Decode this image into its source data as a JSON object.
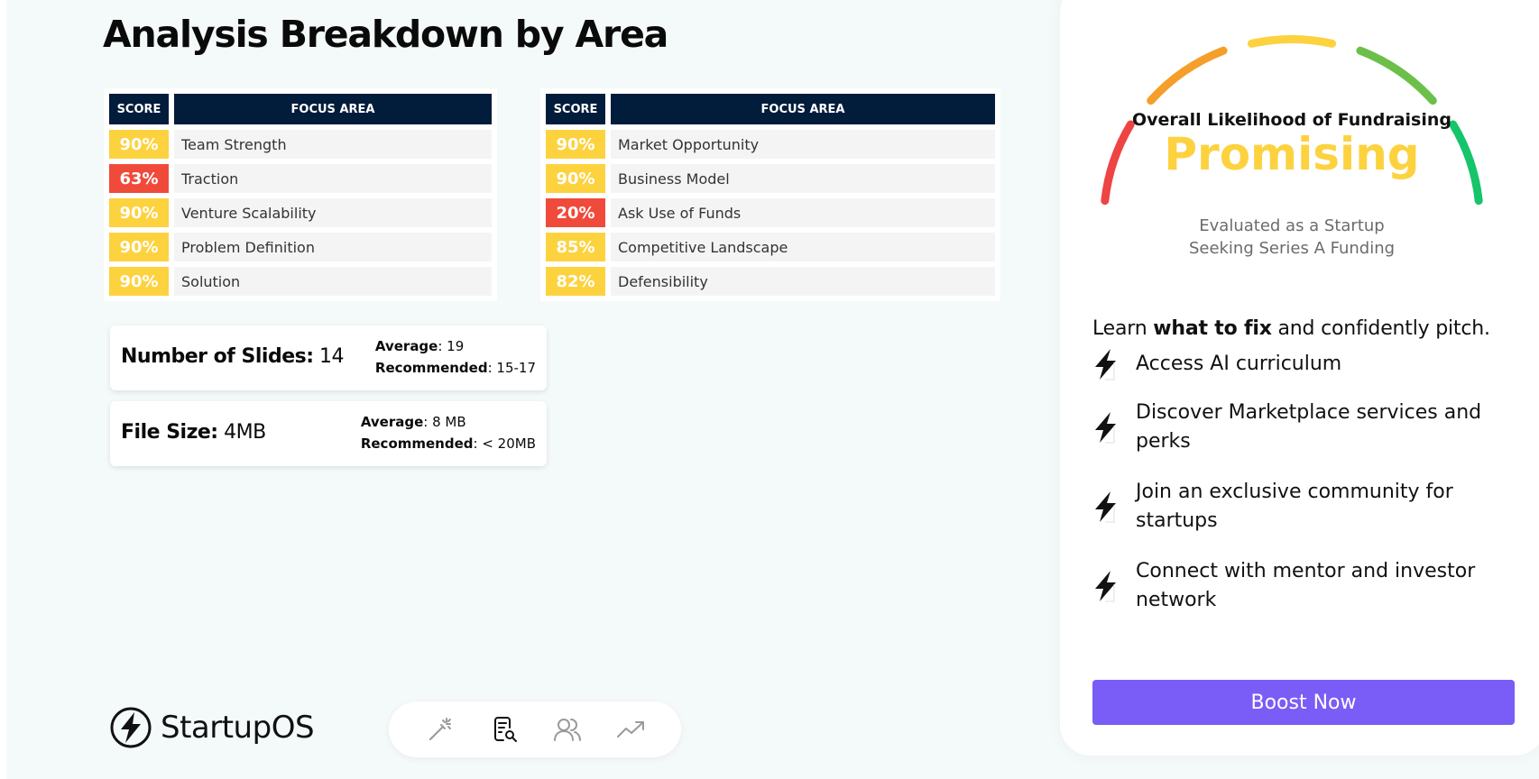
{
  "page": {
    "title": "Analysis Breakdown by Area"
  },
  "tables": {
    "score_header": "SCORE",
    "focus_header": "FOCUS AREA",
    "left": [
      {
        "score": "90%",
        "area": "Team Strength",
        "level": "high"
      },
      {
        "score": "63%",
        "area": "Traction",
        "level": "low"
      },
      {
        "score": "90%",
        "area": "Venture Scalability",
        "level": "high"
      },
      {
        "score": "90%",
        "area": "Problem Definition",
        "level": "high"
      },
      {
        "score": "90%",
        "area": "Solution",
        "level": "high"
      }
    ],
    "right": [
      {
        "score": "90%",
        "area": "Market Opportunity",
        "level": "high"
      },
      {
        "score": "90%",
        "area": "Business Model",
        "level": "high"
      },
      {
        "score": "20%",
        "area": "Ask Use of Funds",
        "level": "low"
      },
      {
        "score": "85%",
        "area": "Competitive Landscape",
        "level": "high"
      },
      {
        "score": "82%",
        "area": "Defensibility",
        "level": "high"
      }
    ]
  },
  "stats": {
    "slides": {
      "label": "Number of Slides:",
      "value": "14",
      "average_label": "Average",
      "average_value": ": 19",
      "recommended_label": "Recommended",
      "recommended_value": ": 15-17"
    },
    "filesize": {
      "label": "File Size:",
      "value": "4MB",
      "average_label": "Average",
      "average_value": ": 8 MB",
      "recommended_label": "Recommended",
      "recommended_value": ": < 20MB"
    }
  },
  "footer": {
    "brand": "StartupOS",
    "toolbar_icons": [
      "magic-wand-icon",
      "document-search-icon",
      "users-icon",
      "trending-up-icon"
    ]
  },
  "panel": {
    "gauge_title": "Overall Likelihood of Fundraising",
    "status": "Promising",
    "evaluated_line1": "Evaluated as a Startup",
    "evaluated_line2": "Seeking Series A Funding",
    "learn_prefix": "Learn ",
    "learn_bold": "what to fix",
    "learn_suffix": " and confidently pitch.",
    "benefits": [
      "Access AI curriculum",
      "Discover Marketplace services and perks",
      "Join an exclusive community for startups",
      "Connect with mentor and investor network"
    ],
    "boost_label": "Boost Now"
  },
  "colors": {
    "score_high": "#fdd23f",
    "score_low": "#f04a3b",
    "header_navy": "#021c3b",
    "boost_purple": "#7a5cf6",
    "status_yellow": "#fdd23f",
    "gauge_segments": [
      "#ef4444",
      "#f59e2a",
      "#fdd23f",
      "#6cc04a",
      "#16c46a"
    ]
  }
}
